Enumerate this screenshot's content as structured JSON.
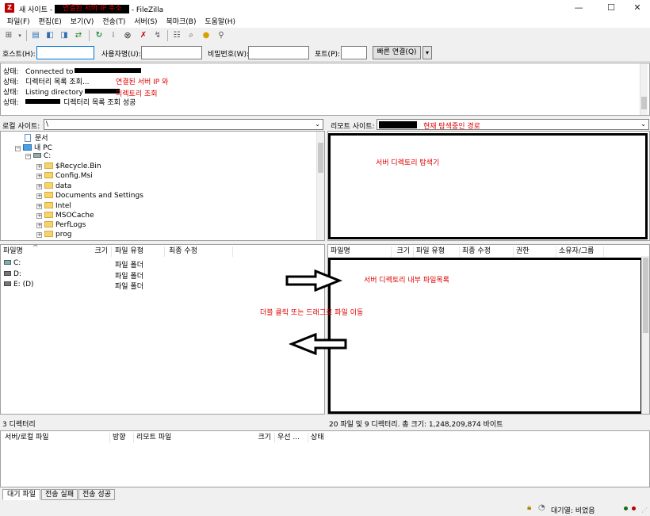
{
  "window": {
    "title_prefix": "새 사이트 - ",
    "title_redacted_annotation": "연결된 서버 IP 주소",
    "title_suffix": " - FileZilla",
    "minimize": "—",
    "maximize": "☐",
    "close": "✕"
  },
  "menu": [
    "파일(F)",
    "편집(E)",
    "보기(V)",
    "전송(T)",
    "서버(S)",
    "북마크(B)",
    "도움말(H)"
  ],
  "quickconnect": {
    "host_label": "호스트(H):",
    "user_label": "사용자명(U):",
    "pass_label": "비밀번호(W):",
    "port_label": "포트(P):",
    "button_label": "빠른 연결(Q)",
    "dropdown": "▾"
  },
  "log": {
    "lines": [
      {
        "label": "상태:",
        "text": "Connected to"
      },
      {
        "label": "상태:",
        "text": "디렉터리 목록 조회..."
      },
      {
        "label": "상태:",
        "text": "Listing directory"
      },
      {
        "label": "상태:",
        "text": "디렉터리 목록 조회 성공"
      }
    ],
    "annotation_line1": "연결된 서버 IP 와",
    "annotation_line2": "디렉토리 조회"
  },
  "local": {
    "site_label": "로컬 사이트:",
    "path": "\\",
    "tree": {
      "documents": "문서",
      "pc": "내 PC",
      "drive": "C:",
      "folders": [
        "$Recycle.Bin",
        "Config.Msi",
        "data",
        "Documents and Settings",
        "Intel",
        "MSOCache",
        "PerfLogs",
        "prog"
      ]
    },
    "columns": [
      "파일명",
      "크기",
      "파일 유형",
      "최종 수정"
    ],
    "sort_arrow": "^",
    "rows": [
      {
        "name": "C:",
        "type": "파일 폴더"
      },
      {
        "name": "D:",
        "type": "파일 폴더"
      },
      {
        "name": "E: (D)",
        "type": "파일 폴더"
      }
    ],
    "status": "3 디렉터리"
  },
  "remote": {
    "site_label": "리모트 사이트:",
    "path_annotation": "현재 탐색중인 경로",
    "tree_annotation": "서버 디렉토리 탐색기",
    "columns": [
      "파일명",
      "크기",
      "파일 유형",
      "최종 수정",
      "권한",
      "소유자/그룹"
    ],
    "list_annotation": "서버 디렉토리 내부 파일목록",
    "status": "20 파일 및 9 디렉터리. 총 크기: 1,248,209,874 바이트"
  },
  "center_annotation": "더블 클릭 또는 드래그로 파일 이동",
  "queue": {
    "columns": [
      "서버/로컬 파일",
      "방향",
      "리모트 파일",
      "크기",
      "우선 ...",
      "상태"
    ],
    "tabs": [
      "대기 파일",
      "전송 실패",
      "전송 성공"
    ]
  },
  "statusbar": {
    "queue": "대기열: 비었음"
  },
  "colors": {
    "annotation": "#e00000",
    "folder": "#f6d46d"
  }
}
